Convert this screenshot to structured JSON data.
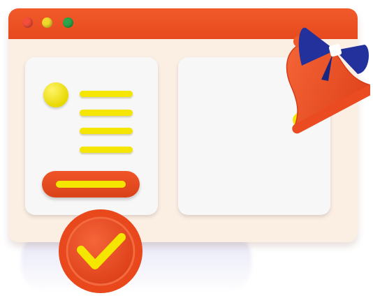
{
  "colors": {
    "primary": "#ef5024",
    "accent": "#f4e600",
    "window_bg": "#fbeee3",
    "card_bg": "#f7f7f7",
    "bow": "#22319c",
    "dot_close": "#f24e3b",
    "dot_minimize": "#f1d92b",
    "dot_maximize": "#2ea54a"
  },
  "window": {
    "controls": [
      "close-dot",
      "minimize-dot",
      "maximize-dot"
    ]
  },
  "left_card": {
    "avatar_icon": "avatar-circle-icon",
    "text_lines": 4,
    "button_icon": "cta-bar"
  },
  "right_card": {
    "content": "empty-panel"
  },
  "decorations": {
    "bell_icon": "bell-with-bow-icon",
    "check_icon": "checkmark-badge-icon"
  }
}
